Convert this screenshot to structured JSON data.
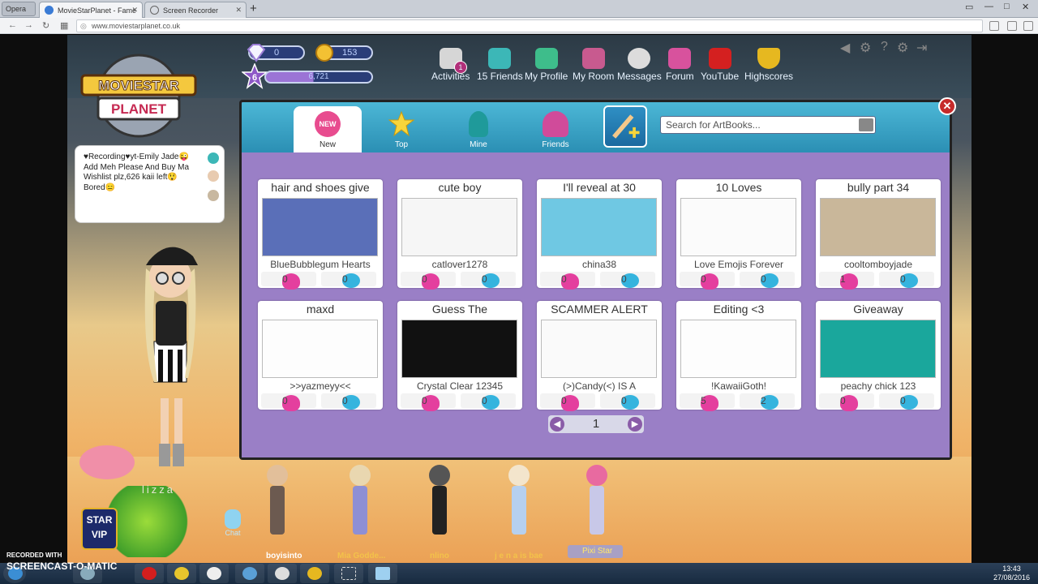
{
  "browser": {
    "menu_label": "Opera",
    "tabs": [
      {
        "label": "MovieStarPlanet - Fame"
      },
      {
        "label": "Screen Recorder"
      }
    ],
    "new_tab": "+",
    "url": "www.moviestarplanet.co.uk"
  },
  "game": {
    "logo": {
      "line1": "MOVIESTAR",
      "line2": "PLANET"
    },
    "stats": {
      "diamonds": "0",
      "coins": "153",
      "level": "6",
      "fame": "6,721"
    },
    "menu": [
      {
        "label": "Activities",
        "badge": "1",
        "icon": "activities-icon"
      },
      {
        "label": "15 Friends",
        "icon": "friends-icon"
      },
      {
        "label": "My Profile",
        "icon": "profile-icon"
      },
      {
        "label": "My Room",
        "icon": "room-icon"
      },
      {
        "label": "Messages",
        "icon": "messages-icon"
      },
      {
        "label": "Forum",
        "icon": "forum-icon"
      },
      {
        "label": "YouTube",
        "icon": "youtube-icon"
      },
      {
        "label": "Highscores",
        "icon": "trophy-icon"
      }
    ],
    "chat_bubble": {
      "line1": "♥Recording♥yt-Emily Jade😜",
      "line2": "Add Meh Please And Buy Ma",
      "line3": "Wishlist plz,626 kaii left😲",
      "line4": "Bored😑"
    },
    "username": "lizza",
    "vip": {
      "line1": "STAR",
      "line2": "VIP"
    },
    "chat_label": "Chat",
    "avatars": [
      {
        "name": "boyisinto",
        "color": "#ffffff"
      },
      {
        "name": "Mia Godde...",
        "color": "#f3c24a"
      },
      {
        "name": "nlino",
        "color": "#f3c24a"
      },
      {
        "name": "j e n a is bae",
        "color": "#f3c24a"
      }
    ],
    "pixi_star": "Pixi Star"
  },
  "artbooks": {
    "tabs": [
      {
        "label": "New",
        "badge": "NEW"
      },
      {
        "label": "Top"
      },
      {
        "label": "Mine"
      },
      {
        "label": "Friends"
      }
    ],
    "search_placeholder": "Search for ArtBooks...",
    "close": "✕",
    "page": "1",
    "cards": [
      {
        "title": "hair and shoes give",
        "author": "BlueBubblegum Hearts",
        "likes": "0",
        "comments": "0",
        "thumb": "#5a6fb8"
      },
      {
        "title": "cute boy",
        "author": "catlover1278",
        "likes": "0",
        "comments": "0",
        "thumb": "#f6f6f6"
      },
      {
        "title": "I'll reveal at 30",
        "author": "china38",
        "likes": "0",
        "comments": "0",
        "thumb": "#6fc8e3"
      },
      {
        "title": "10 Loves",
        "author": "Love Emojis Forever",
        "likes": "0",
        "comments": "0",
        "thumb": "#fbfbfb"
      },
      {
        "title": "bully part 34",
        "author": "cooltomboyjade",
        "likes": "1",
        "comments": "0",
        "thumb": "#c9b79a"
      },
      {
        "title": "maxd",
        "author": ">>yazmeyy<<",
        "likes": "0",
        "comments": "0",
        "thumb": "#fdfdfd"
      },
      {
        "title": "Guess The",
        "author": "Crystal Clear 12345",
        "likes": "0",
        "comments": "0",
        "thumb": "#111111"
      },
      {
        "title": "SCAMMER ALERT",
        "author": "(>)Candy(<) IS A",
        "likes": "0",
        "comments": "0",
        "thumb": "#fafafa"
      },
      {
        "title": "Editing <3",
        "author": "!KawaiiGoth!",
        "likes": "5",
        "comments": "2",
        "thumb": "#fdfdfd"
      },
      {
        "title": "Giveaway",
        "author": "peachy chick 123",
        "likes": "0",
        "comments": "0",
        "thumb": "#1aa79c"
      }
    ]
  },
  "taskbar": {
    "watermark_line1": "RECORDED WITH",
    "watermark_line2": "SCREENCAST-O-MATIC",
    "time": "13:43",
    "date": "27/08/2016"
  }
}
